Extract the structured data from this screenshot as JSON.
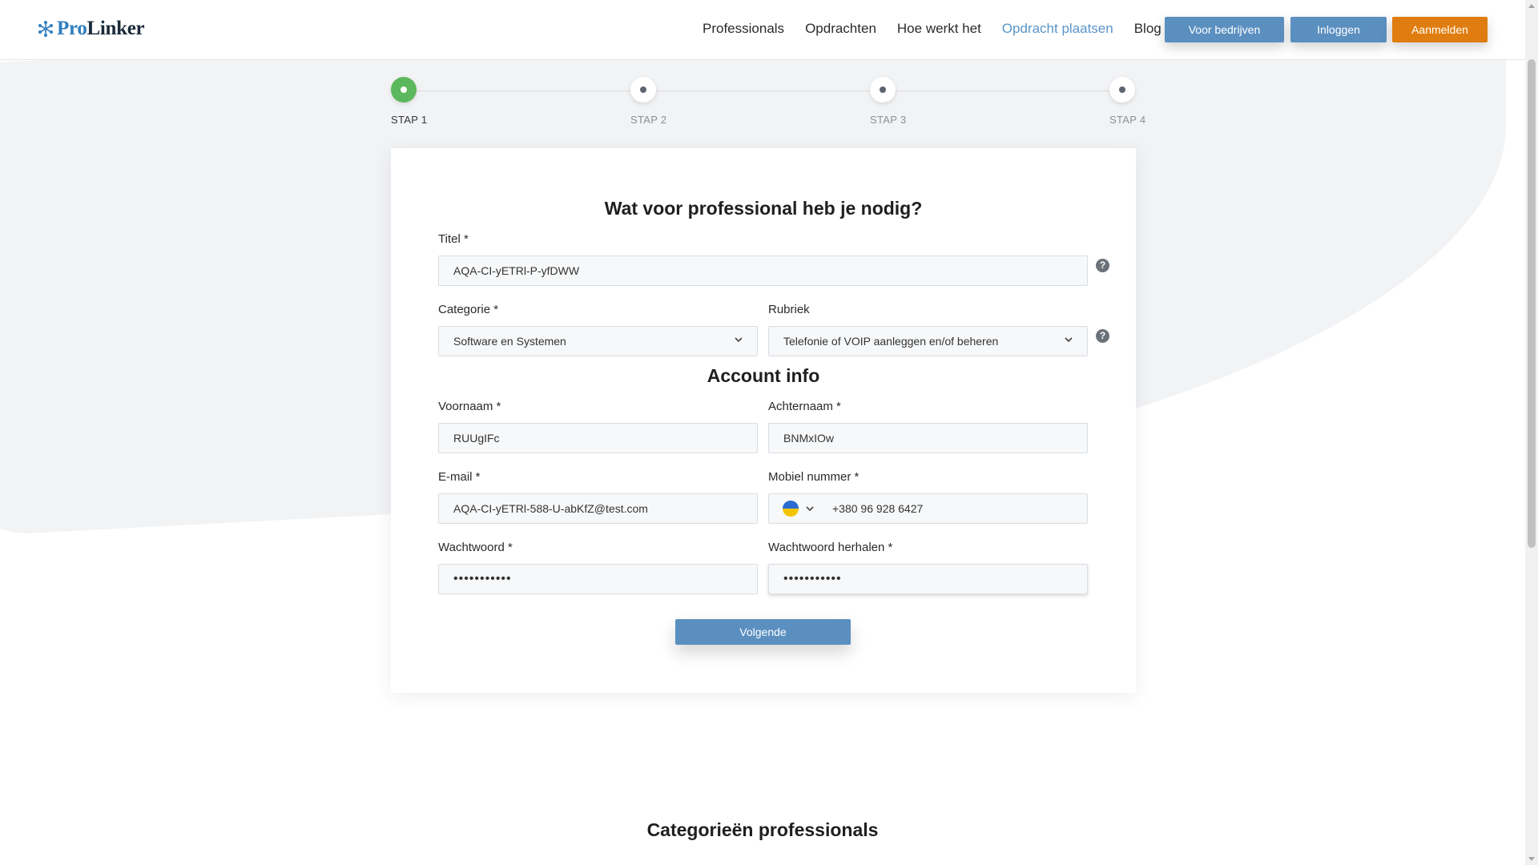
{
  "header": {
    "logo": {
      "pro": "Pro",
      "linker": "Linker"
    },
    "nav": [
      "Professionals",
      "Opdrachten",
      "Hoe werkt het",
      "Opdracht plaatsen",
      "Blog"
    ],
    "active_nav": "Opdracht plaatsen",
    "buttons": {
      "business": "Voor bedrijven",
      "login": "Inloggen",
      "signup": "Aanmelden"
    },
    "colors": {
      "primary": "#5b8fc0",
      "signup": "#e07d10",
      "logo_blue": "#2f7fc0"
    }
  },
  "stepper": {
    "steps": [
      "STAP 1",
      "STAP 2",
      "STAP 3",
      "STAP 4"
    ],
    "current_step": 1,
    "active_color": "#5cb85c"
  },
  "form": {
    "heading": "Wat voor professional heb je nodig?",
    "title": {
      "label": "Titel *",
      "value": "AQA-CI-yETRl-P-yfDWW"
    },
    "category": {
      "label": "Categorie *",
      "value": "Software en Systemen"
    },
    "rubriek": {
      "label": "Rubriek",
      "value": "Telefonie of VOIP aanleggen en/of beheren"
    },
    "account_heading": "Account info",
    "firstname": {
      "label": "Voornaam *",
      "value": "RUUgIFc"
    },
    "lastname": {
      "label": "Achternaam *",
      "value": "BNMxIOw"
    },
    "email": {
      "label": "E-mail *",
      "value": "AQA-CI-yETRl-588-U-abKfZ@test.com"
    },
    "mobile": {
      "label": "Mobiel nummer *",
      "value": "+380 96 928 6427",
      "country_icon": "ukraine-flag-icon"
    },
    "password": {
      "label": "Wachtwoord *",
      "value": "•••••••••••"
    },
    "password_repeat": {
      "label": "Wachtwoord herhalen *",
      "value": "•••••••••••"
    },
    "next_button": "Volgende",
    "help_symbol": "?"
  },
  "section_title": "Categorieën professionals"
}
